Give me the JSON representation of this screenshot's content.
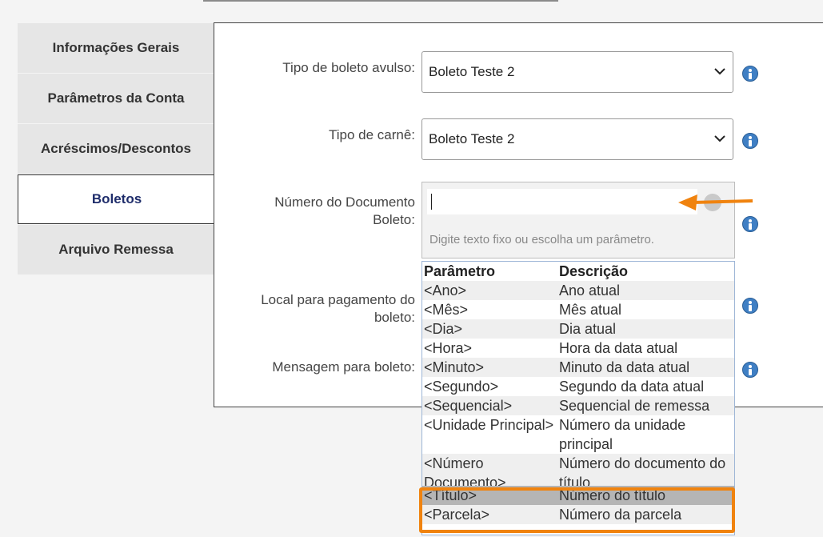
{
  "tabs": [
    {
      "label": "Informações Gerais"
    },
    {
      "label": "Parâmetros da Conta"
    },
    {
      "label": "Acréscimos/Descontos"
    },
    {
      "label": "Boletos"
    },
    {
      "label": "Arquivo Remessa"
    }
  ],
  "form": {
    "tipo_boleto_label": "Tipo de boleto avulso:",
    "tipo_boleto_value": "Boleto Teste 2",
    "tipo_carne_label": "Tipo de carnê:",
    "tipo_carne_value": "Boleto Teste 2",
    "numero_doc_label_line1": "Número do Documento",
    "numero_doc_label_line2": "Boleto:",
    "numero_doc_value": "",
    "numero_doc_hint": "Digite texto fixo ou escolha um parâmetro.",
    "local_pagamento_label_line1": "Local para pagamento do",
    "local_pagamento_label_line2": "boleto:",
    "mensagem_label": "Mensagem para boleto:"
  },
  "param_table": {
    "headers": [
      "Parâmetro",
      "Descrição"
    ],
    "rows": [
      {
        "param": "<Ano>",
        "desc": "Ano atual"
      },
      {
        "param": "<Mês>",
        "desc": "Mês atual"
      },
      {
        "param": "<Dia>",
        "desc": "Dia atual"
      },
      {
        "param": "<Hora>",
        "desc": "Hora da data atual"
      },
      {
        "param": "<Minuto>",
        "desc": "Minuto da data atual"
      },
      {
        "param": "<Segundo>",
        "desc": "Segundo da data atual"
      },
      {
        "param": "<Sequencial>",
        "desc": "Sequencial de remessa"
      },
      {
        "param": "<Unidade Principal>",
        "desc": "Número da unidade principal"
      },
      {
        "param": "<Número Documento>",
        "desc": "Número do documento do título"
      },
      {
        "param": "<Título>",
        "desc": "Número do título"
      },
      {
        "param": "<Parcela>",
        "desc": "Número da parcela"
      }
    ]
  },
  "colors": {
    "accent": "#f0830f",
    "active_tab_text": "#1f2d6b",
    "info_icon": "#3f7fc4"
  },
  "icons": [
    "chevron-down-icon",
    "info-icon",
    "arrow-left-icon"
  ]
}
